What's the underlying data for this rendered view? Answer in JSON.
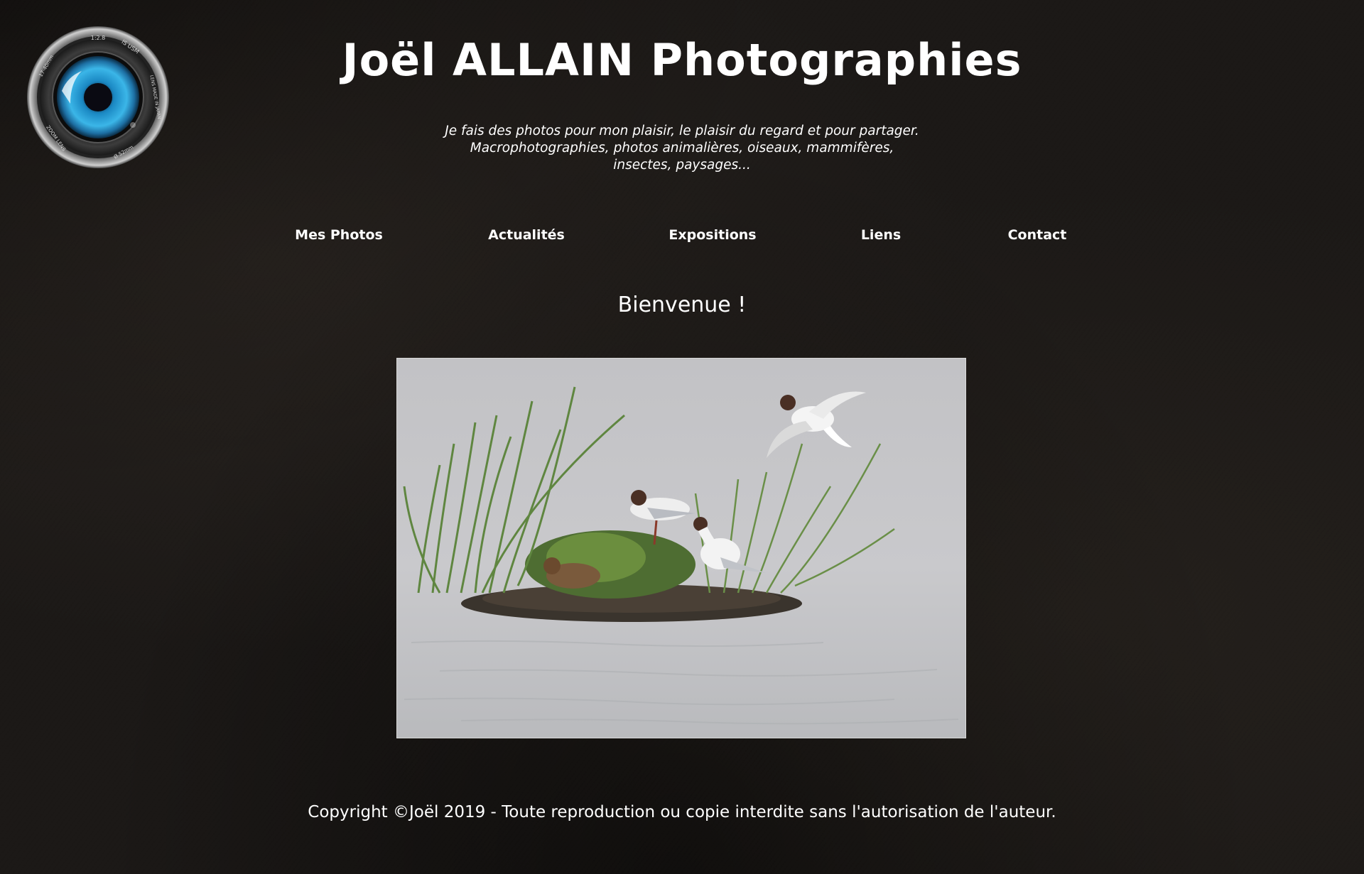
{
  "header": {
    "title": "Joël ALLAIN Photographies",
    "tagline": [
      "Je fais des photos pour mon plaisir, le plaisir du regard et pour partager.",
      "Macrophotographies, photos animalières, oiseaux, mammifères,",
      "insectes, paysages..."
    ],
    "logo_icon": "camera-lens-icon",
    "logo_lens_text": {
      "aperture": "1:2.8",
      "stabilizer": "IS USM",
      "focal": "17-40mm",
      "made_in": "LENS MADE IN JAPAN",
      "filter": "Ø 52mm",
      "brand": "ZOOM LENS"
    }
  },
  "nav": {
    "items": [
      {
        "label": "Mes Photos"
      },
      {
        "label": "Actualités"
      },
      {
        "label": "Expositions"
      },
      {
        "label": "Liens"
      },
      {
        "label": "Contact"
      }
    ]
  },
  "main": {
    "welcome": "Bienvenue !",
    "photo_alt": "Mouettes rieuses sur un îlot de roseaux"
  },
  "footer": {
    "copyright": "Copyright ©Joël 2019 - Toute reproduction ou copie interdite sans l'autorisation de l'auteur."
  },
  "colors": {
    "background": "#1c1917",
    "text": "#ffffff",
    "lens_iris": "#2fa9e0",
    "photo_water": "#c9c9cb",
    "reeds": "#5a7a3a"
  }
}
